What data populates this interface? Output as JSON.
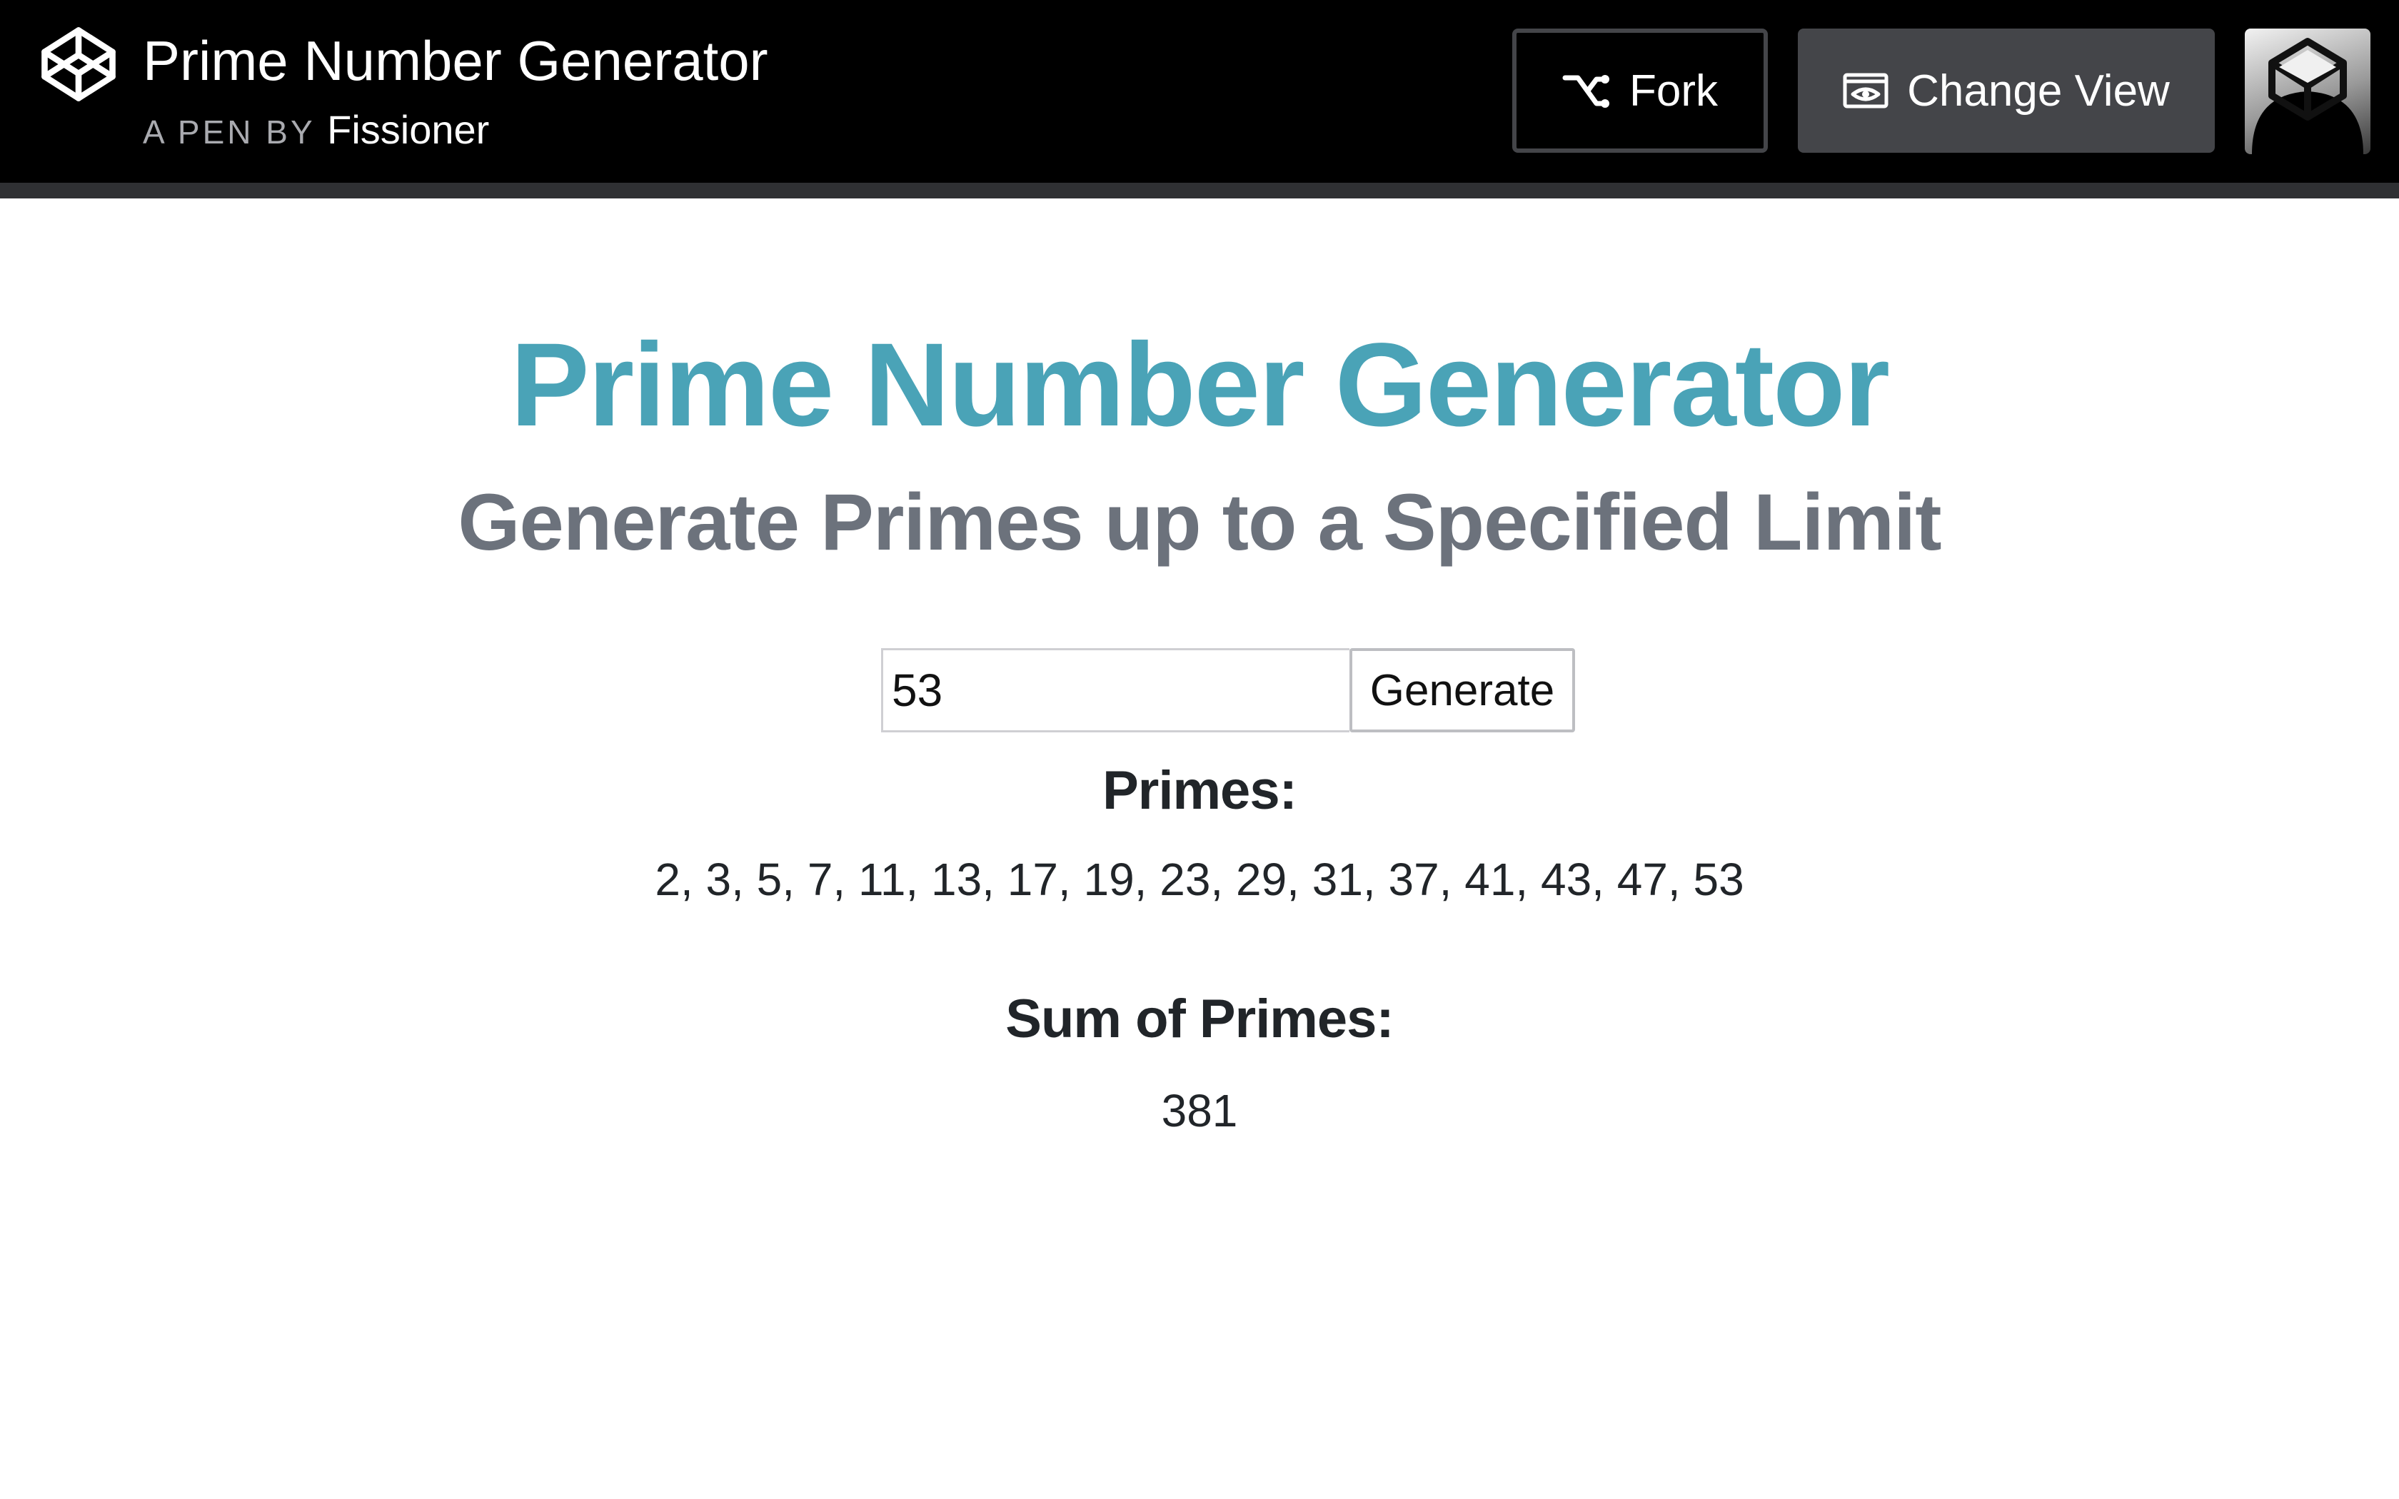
{
  "header": {
    "pen_title": "Prime Number Generator",
    "byline_prefix": "A PEN BY",
    "author": "Fissioner",
    "fork_label": "Fork",
    "change_view_label": "Change View",
    "icons": {
      "logo": "codepen-logo-icon",
      "fork": "fork-icon",
      "change_view": "eye-icon"
    }
  },
  "main": {
    "title": "Prime Number Generator",
    "subtitle": "Generate Primes up to a Specified Limit",
    "limit_value": "53",
    "generate_label": "Generate",
    "primes_heading": "Primes:",
    "primes_value": "2, 3, 5, 7, 11, 13, 17, 19, 23, 29, 31, 37, 41, 43, 47, 53",
    "sum_heading": "Sum of Primes:",
    "sum_value": "381"
  },
  "colors": {
    "header_bg": "#000000",
    "title_accent": "#4aa3b7",
    "subtitle": "#6c727c",
    "body_text": "#212529"
  }
}
